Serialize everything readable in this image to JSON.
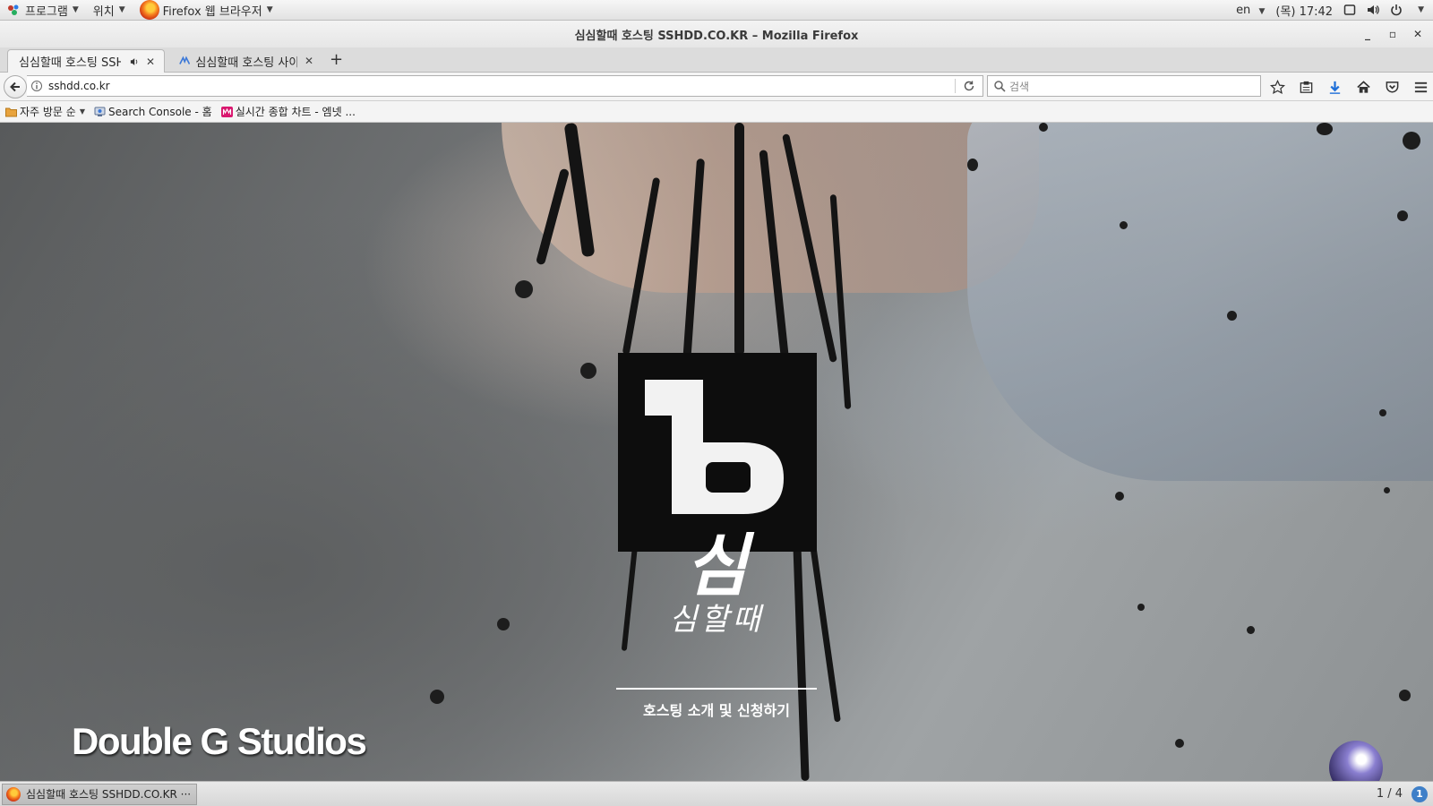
{
  "topbar": {
    "apps_label": "프로그램",
    "places_label": "위치",
    "app_menu_label": "Firefox 웹 브라우저",
    "keyboard_layout": "en",
    "clock": "(목) 17:42"
  },
  "window": {
    "title": "심심할때 호스팅 SSHDD.CO.KR – Mozilla Firefox"
  },
  "tabs": [
    {
      "label": "심심할때 호스팅 SSH...",
      "active": true
    },
    {
      "label": "심심할때 호스팅 사이...",
      "active": false
    }
  ],
  "navbar": {
    "url": "sshdd.co.kr",
    "search_placeholder": "검색"
  },
  "bookmarks": [
    {
      "label": "자주 방문 순"
    },
    {
      "label": "Search Console - 홈"
    },
    {
      "label": "실시간 종합 차트 - 엠넷 ..."
    }
  ],
  "page": {
    "logo_script_big": "심",
    "logo_script_small": "심할때",
    "cta_label": "호스팅 소개 및 신청하기",
    "watermark": "Double G Studios"
  },
  "taskbar": {
    "item_label": "심심할때 호스팅 SSHDD.CO.KR ···",
    "pager": "1 / 4",
    "notify_glyph": "1"
  }
}
